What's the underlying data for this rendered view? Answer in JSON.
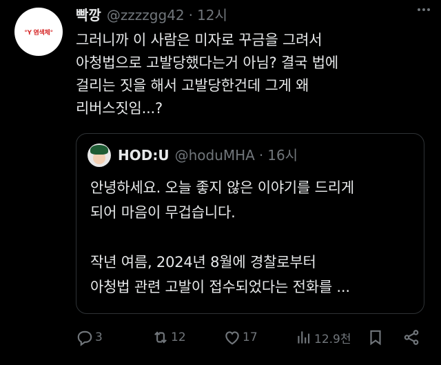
{
  "tweet": {
    "avatar_text": "°Y 염색체°",
    "author_name": "빡깡",
    "handle": "@zzzzgg42",
    "separator": "·",
    "time": "12시",
    "text": "그러니까 이 사람은 미자로 꾸금을 그려서\n아청법으로 고발당했다는거 아님? 결국 법에\n걸리는 짓을 해서 고발당한건데 그게 왜\n리버스짓임...?"
  },
  "quote": {
    "author_name": "HOD:U",
    "handle": "@hoduMHA",
    "separator": "·",
    "time": "16시",
    "text": "안녕하세요. 오늘 좋지 않은 이야기를 드리게\n되어 마음이 무겁습니다.\n\n작년 여름, 2024년 8월에 경찰로부터\n아청법 관련 고발이 접수되었다는 전화를 ..."
  },
  "actions": {
    "replies": "3",
    "retweets": "12",
    "likes": "17",
    "views": "12.9천"
  },
  "icons": {
    "more": "more-icon",
    "reply": "reply-icon",
    "retweet": "retweet-icon",
    "like": "heart-icon",
    "views": "views-icon",
    "bookmark": "bookmark-icon",
    "share": "share-icon"
  }
}
